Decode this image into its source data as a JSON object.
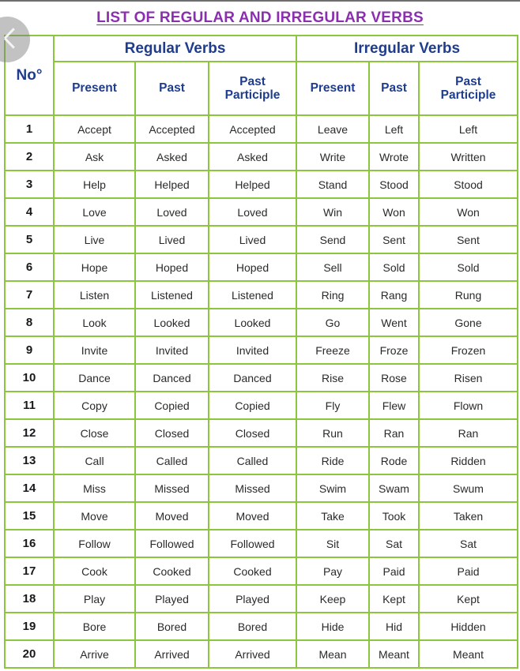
{
  "page": {
    "title": "LIST OF REGULAR AND IRREGULAR VERBS",
    "title_color": "#8B2FB0",
    "border_color": "#8CC63F",
    "header_text_color": "#1F3D8F",
    "body_text_color": "#2B2A2B"
  },
  "carousel": {
    "prev_label": "‹",
    "prev_icon": "chevron-left-icon"
  },
  "table": {
    "row_number_header": "No°",
    "groups": [
      {
        "label": "Regular Verbs",
        "span": 3
      },
      {
        "label": "Irregular Verbs",
        "span": 3
      }
    ],
    "subheaders": [
      "Present",
      "Past",
      "Past Participle",
      "Present",
      "Past",
      "Past Participle"
    ],
    "subheaders_display": [
      "Present",
      "Past",
      "Past\nParticiple",
      "Present",
      "Past",
      "Past\nParticiple"
    ],
    "rows": [
      {
        "no": "1",
        "regular": [
          "Accept",
          "Accepted",
          "Accepted"
        ],
        "irregular": [
          "Leave",
          "Left",
          "Left"
        ]
      },
      {
        "no": "2",
        "regular": [
          "Ask",
          "Asked",
          "Asked"
        ],
        "irregular": [
          "Write",
          "Wrote",
          "Written"
        ]
      },
      {
        "no": "3",
        "regular": [
          "Help",
          "Helped",
          "Helped"
        ],
        "irregular": [
          "Stand",
          "Stood",
          "Stood"
        ]
      },
      {
        "no": "4",
        "regular": [
          "Love",
          "Loved",
          "Loved"
        ],
        "irregular": [
          "Win",
          "Won",
          "Won"
        ]
      },
      {
        "no": "5",
        "regular": [
          "Live",
          "Lived",
          "Lived"
        ],
        "irregular": [
          "Send",
          "Sent",
          "Sent"
        ]
      },
      {
        "no": "6",
        "regular": [
          "Hope",
          "Hoped",
          "Hoped"
        ],
        "irregular": [
          "Sell",
          "Sold",
          "Sold"
        ]
      },
      {
        "no": "7",
        "regular": [
          "Listen",
          "Listened",
          "Listened"
        ],
        "irregular": [
          "Ring",
          "Rang",
          "Rung"
        ]
      },
      {
        "no": "8",
        "regular": [
          "Look",
          "Looked",
          "Looked"
        ],
        "irregular": [
          "Go",
          "Went",
          "Gone"
        ]
      },
      {
        "no": "9",
        "regular": [
          "Invite",
          "Invited",
          "Invited"
        ],
        "irregular": [
          "Freeze",
          "Froze",
          "Frozen"
        ]
      },
      {
        "no": "10",
        "regular": [
          "Dance",
          "Danced",
          "Danced"
        ],
        "irregular": [
          "Rise",
          "Rose",
          "Risen"
        ]
      },
      {
        "no": "11",
        "regular": [
          "Copy",
          "Copied",
          "Copied"
        ],
        "irregular": [
          "Fly",
          "Flew",
          "Flown"
        ]
      },
      {
        "no": "12",
        "regular": [
          "Close",
          "Closed",
          "Closed"
        ],
        "irregular": [
          "Run",
          "Ran",
          "Ran"
        ]
      },
      {
        "no": "13",
        "regular": [
          "Call",
          "Called",
          "Called"
        ],
        "irregular": [
          "Ride",
          "Rode",
          "Ridden"
        ]
      },
      {
        "no": "14",
        "regular": [
          "Miss",
          "Missed",
          "Missed"
        ],
        "irregular": [
          "Swim",
          "Swam",
          "Swum"
        ]
      },
      {
        "no": "15",
        "regular": [
          "Move",
          "Moved",
          "Moved"
        ],
        "irregular": [
          "Take",
          "Took",
          "Taken"
        ]
      },
      {
        "no": "16",
        "regular": [
          "Follow",
          "Followed",
          "Followed"
        ],
        "irregular": [
          "Sit",
          "Sat",
          "Sat"
        ]
      },
      {
        "no": "17",
        "regular": [
          "Cook",
          "Cooked",
          "Cooked"
        ],
        "irregular": [
          "Pay",
          "Paid",
          "Paid"
        ]
      },
      {
        "no": "18",
        "regular": [
          "Play",
          "Played",
          "Played"
        ],
        "irregular": [
          "Keep",
          "Kept",
          "Kept"
        ]
      },
      {
        "no": "19",
        "regular": [
          "Bore",
          "Bored",
          "Bored"
        ],
        "irregular": [
          "Hide",
          "Hid",
          "Hidden"
        ]
      },
      {
        "no": "20",
        "regular": [
          "Arrive",
          "Arrived",
          "Arrived"
        ],
        "irregular": [
          "Mean",
          "Meant",
          "Meant"
        ]
      }
    ]
  }
}
